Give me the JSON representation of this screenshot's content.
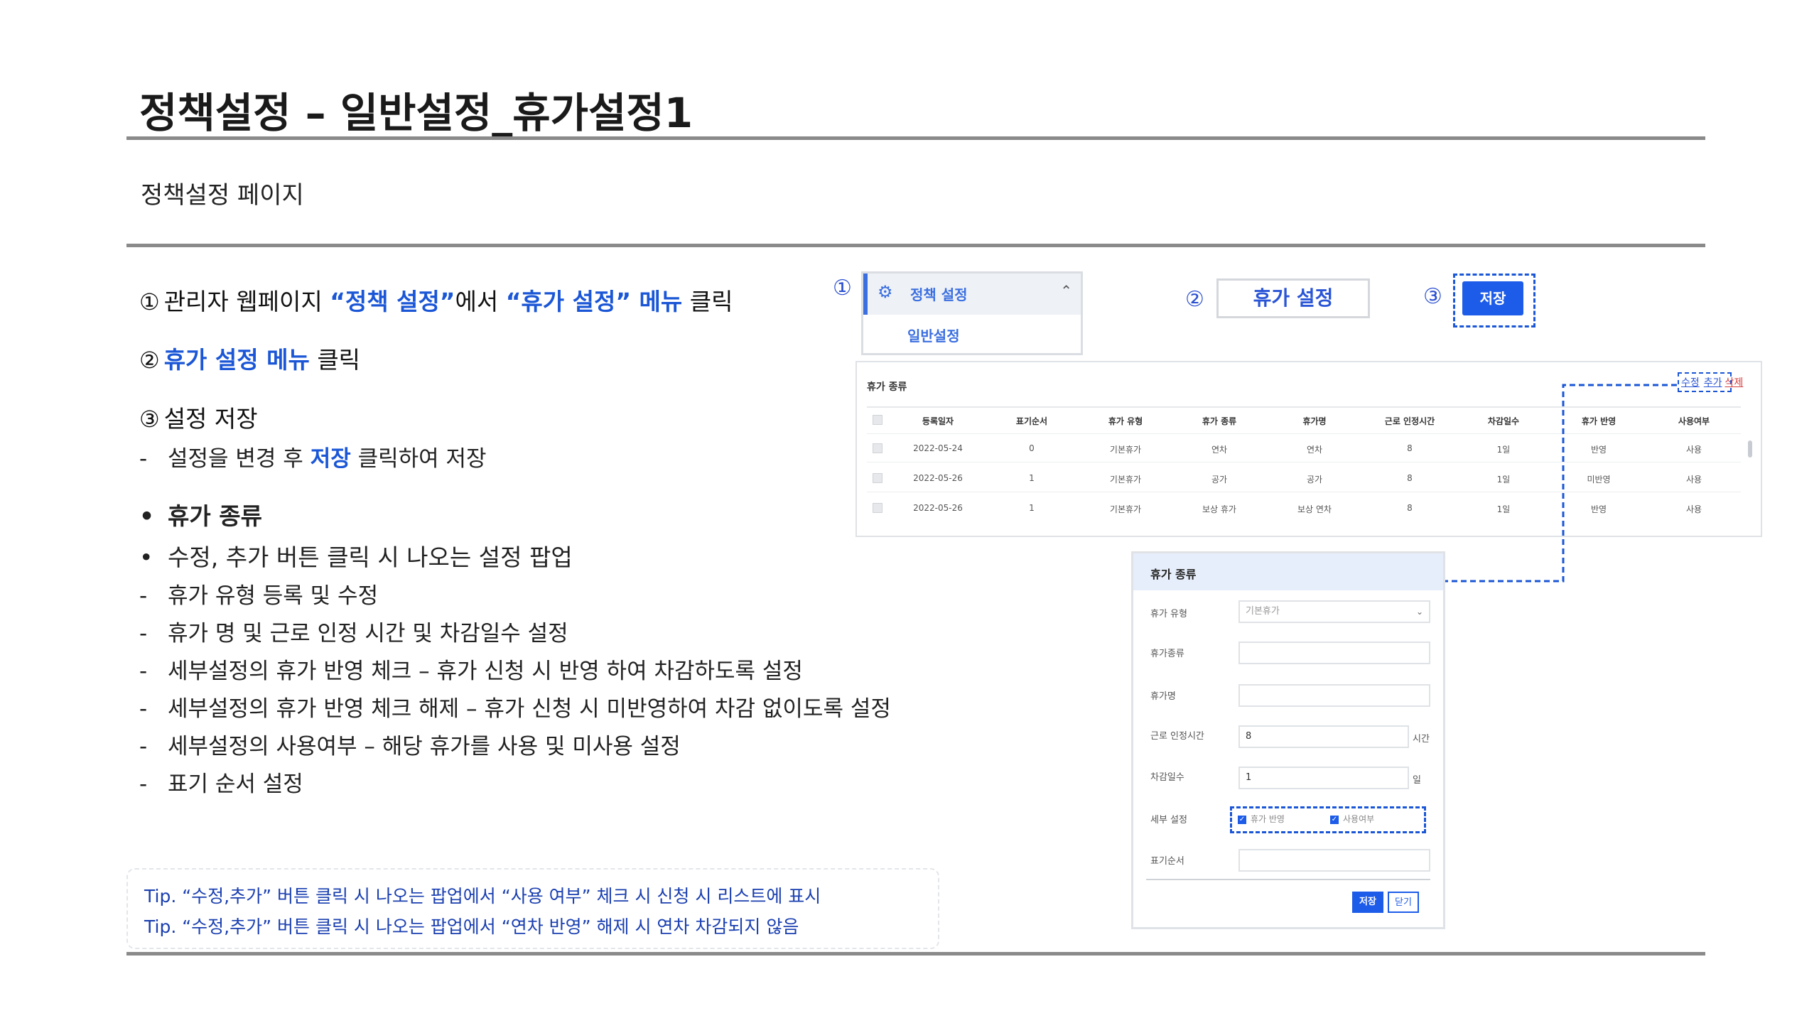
{
  "title": "정책설정 – 일반설정_휴가설정1",
  "subtitle": "정책설정 페이지",
  "steps": {
    "s1_num": "①",
    "s1_a": "관리자 웹페이지 ",
    "s1_b": "“정책 설정”",
    "s1_c": "에서 ",
    "s1_d": "“휴가 설정” 메뉴",
    "s1_e": " 클릭",
    "s2_num": "②",
    "s2_a": "휴가 설정 메뉴",
    "s2_b": " 클릭",
    "s3_num": "③",
    "s3_a": "설정 저장",
    "s3_dash": "-",
    "s3_sub_a": "설정을 변경 후 ",
    "s3_sub_b": "저장",
    "s3_sub_c": " 클릭하여 저장"
  },
  "bullets": [
    {
      "mark": "•",
      "text": "휴가 종류"
    },
    {
      "mark": "•",
      "text": "수정, 추가 버튼 클릭 시 나오는 설정 팝업"
    },
    {
      "mark": "-",
      "text": "휴가 유형 등록 및 수정"
    },
    {
      "mark": "-",
      "text": "휴가 명 및 근로 인정 시간 및 차감일수 설정"
    },
    {
      "mark": "-",
      "text": "세부설정의 휴가 반영 체크 – 휴가 신청 시 반영 하여 차감하도록 설정"
    },
    {
      "mark": "-",
      "text": "세부설정의 휴가 반영 체크 해제 – 휴가 신청 시 미반영하여 차감 없이도록 설정"
    },
    {
      "mark": "-",
      "text": "세부설정의 사용여부 – 해당 휴가를 사용 및 미사용 설정"
    },
    {
      "mark": "-",
      "text": "표기 순서 설정"
    }
  ],
  "tips": [
    "Tip. “수정,추가” 버튼 클릭 시 나오는 팝업에서 “사용 여부” 체크 시 신청 시 리스트에 표시",
    "Tip. “수정,추가” 버튼 클릭 시 나오는 팝업에서 “연차 반영” 해제 시 연차 차감되지 않음"
  ],
  "shot_menu": {
    "num": "①",
    "gear": "⚙",
    "label": "정책 설정",
    "chevron": "⌃",
    "sub": "일반설정"
  },
  "shot_tab": {
    "num": "②",
    "label": "휴가 설정"
  },
  "shot_save": {
    "num": "③",
    "label": "저장"
  },
  "leave_table": {
    "title": "휴가 종류",
    "actions": {
      "edit": "수정",
      "add": "추가",
      "delete": "삭제"
    },
    "columns": [
      "등록일자",
      "표기순서",
      "휴가 유형",
      "휴가 종류",
      "휴가명",
      "근로 인정시간",
      "차감일수",
      "휴가 반영",
      "사용여부"
    ],
    "rows": [
      [
        "2022-05-24",
        "0",
        "기본휴가",
        "연차",
        "연차",
        "8",
        "1일",
        "반영",
        "사용"
      ],
      [
        "2022-05-26",
        "1",
        "기본휴가",
        "공가",
        "공가",
        "8",
        "1일",
        "미반영",
        "사용"
      ],
      [
        "2022-05-26",
        "1",
        "기본휴가",
        "보상 휴가",
        "보상 연차",
        "8",
        "1일",
        "반영",
        "사용"
      ]
    ]
  },
  "popup": {
    "title": "휴가 종류",
    "type_label": "휴가 유형",
    "type_value": "기본휴가",
    "kind_label": "휴가종류",
    "name_label": "휴가명",
    "hours_label": "근로 인정시간",
    "hours_value": "8",
    "hours_unit": "시간",
    "days_label": "차감일수",
    "days_value": "1",
    "days_unit": "일",
    "detail_label": "세부 설정",
    "detail_opt1": "휴가 반영",
    "detail_opt2": "사용여부",
    "check_mark": "✓",
    "order_label": "표기순서",
    "save": "저장",
    "close": "닫기"
  },
  "colors": {
    "accent": "#1a56d6",
    "button": "#1d5ce8",
    "rule": "#8a8a8a"
  }
}
